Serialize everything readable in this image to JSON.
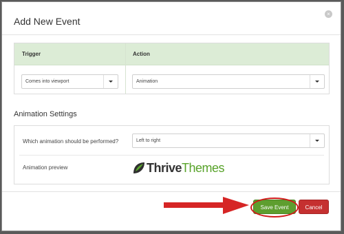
{
  "dialog": {
    "title": "Add New Event",
    "close_glyph": "×"
  },
  "event_table": {
    "headers": {
      "trigger": "Trigger",
      "action": "Action"
    },
    "trigger_select": {
      "value": "Comes into viewport"
    },
    "action_select": {
      "value": "Animation"
    }
  },
  "animation_settings": {
    "heading": "Animation Settings",
    "question_label": "Which animation should be performed?",
    "animation_select": {
      "value": "Left to right"
    },
    "preview_label": "Animation preview",
    "preview_logo": {
      "text_part1": "Thrive",
      "text_part2": "Themes"
    }
  },
  "footer": {
    "save_label": "Save Event",
    "cancel_label": "Cancel"
  },
  "colors": {
    "accent_green": "#5e9e2f",
    "cancel_red": "#c53030",
    "annotation_red": "#d11a1a",
    "header_green": "#dcecd6"
  }
}
